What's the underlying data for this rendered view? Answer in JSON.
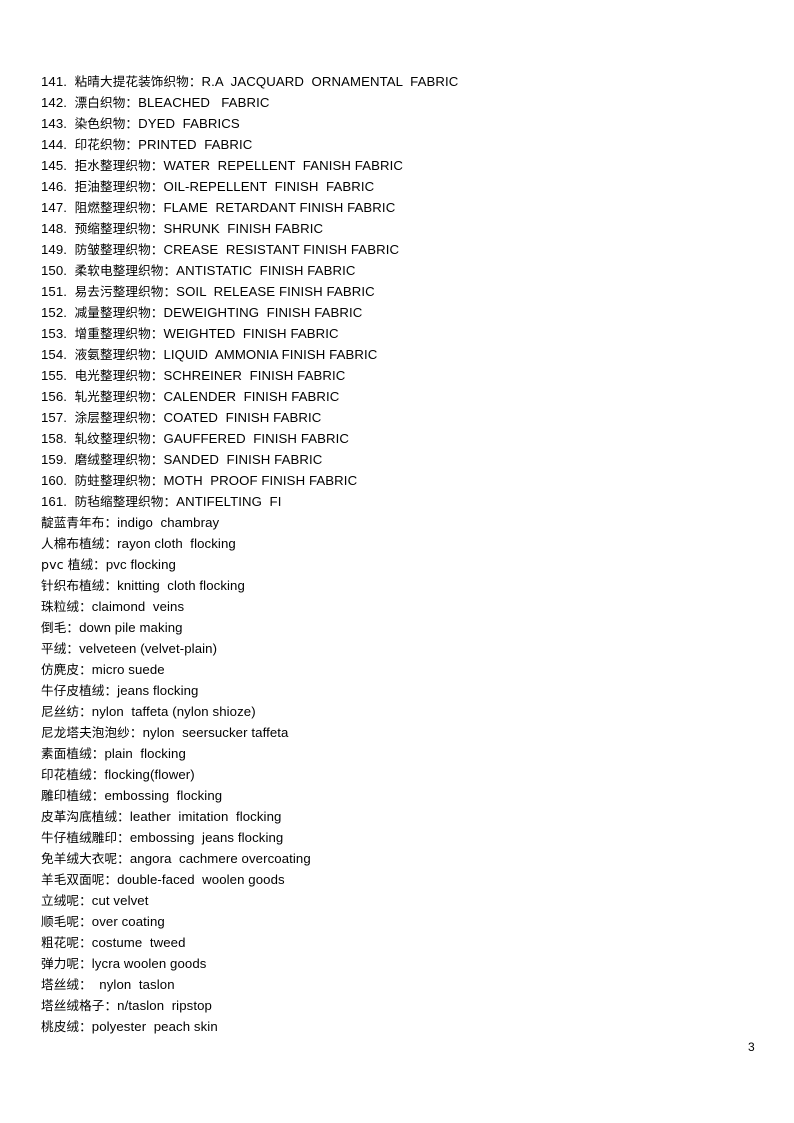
{
  "document": {
    "page_number": "3",
    "entries": [
      {
        "number": "141.",
        "cn": "粘晴大提花装饰织物：",
        "en": "R.A  JACQUARD  ORNAMENTAL  FABRIC"
      },
      {
        "number": "142.",
        "cn": "漂白织物：",
        "en": "BLEACHED   FABRIC"
      },
      {
        "number": "143.",
        "cn": "染色织物：",
        "en": "DYED  FABRICS"
      },
      {
        "number": "144.",
        "cn": "印花织物：",
        "en": "PRINTED  FABRIC"
      },
      {
        "number": "145.",
        "cn": "拒水整理织物：",
        "en": "WATER  REPELLENT  FANISH FABRIC"
      },
      {
        "number": "146.",
        "cn": "拒油整理织物：",
        "en": "OIL-REPELLENT  FINISH  FABRIC"
      },
      {
        "number": "147.",
        "cn": "阻燃整理织物：",
        "en": "FLAME  RETARDANT FINISH FABRIC"
      },
      {
        "number": "148.",
        "cn": "预缩整理织物：",
        "en": "SHRUNK  FINISH FABRIC"
      },
      {
        "number": "149.",
        "cn": "防皱整理织物：",
        "en": "CREASE  RESISTANT FINISH FABRIC"
      },
      {
        "number": "150.",
        "cn": "柔软电整理织物：",
        "en": "ANTISTATIC  FINISH FABRIC"
      },
      {
        "number": "151.",
        "cn": "易去污整理织物：",
        "en": "SOIL  RELEASE FINISH FABRIC"
      },
      {
        "number": "152.",
        "cn": "减量整理织物：",
        "en": "DEWEIGHTING  FINISH FABRIC"
      },
      {
        "number": "153.",
        "cn": "增重整理织物：",
        "en": "WEIGHTED  FINISH FABRIC"
      },
      {
        "number": "154.",
        "cn": "液氨整理织物：",
        "en": "LIQUID  AMMONIA FINISH FABRIC"
      },
      {
        "number": "155.",
        "cn": "电光整理织物：",
        "en": "SCHREINER  FINISH FABRIC"
      },
      {
        "number": "156.",
        "cn": "轧光整理织物：",
        "en": "CALENDER  FINISH FABRIC"
      },
      {
        "number": "157.",
        "cn": "涂层整理织物：",
        "en": "COATED  FINISH FABRIC"
      },
      {
        "number": "158.",
        "cn": "轧纹整理织物：",
        "en": "GAUFFERED  FINISH FABRIC"
      },
      {
        "number": "159.",
        "cn": "磨绒整理织物：",
        "en": "SANDED  FINISH FABRIC"
      },
      {
        "number": "160.",
        "cn": "防蛀整理织物：",
        "en": "MOTH  PROOF FINISH FABRIC"
      },
      {
        "number": "161.",
        "cn": "防毡缩整理织物：",
        "en": "ANTIFELTING  FI"
      },
      {
        "number": "",
        "cn": "靛蓝青年布：",
        "en": "indigo  chambray"
      },
      {
        "number": "",
        "cn": "人棉布植绒：",
        "en": "rayon cloth  flocking"
      },
      {
        "number": "",
        "cn": "pvc 植绒：",
        "en": "pvc flocking"
      },
      {
        "number": "",
        "cn": "针织布植绒：",
        "en": "knitting  cloth flocking"
      },
      {
        "number": "",
        "cn": "珠粒绒：",
        "en": "claimond  veins"
      },
      {
        "number": "",
        "cn": "倒毛：",
        "en": "down pile making"
      },
      {
        "number": "",
        "cn": "平绒：",
        "en": "velveteen (velvet-plain)"
      },
      {
        "number": "",
        "cn": "仿麂皮：",
        "en": "micro suede"
      },
      {
        "number": "",
        "cn": "牛仔皮植绒：",
        "en": "jeans flocking"
      },
      {
        "number": "",
        "cn": "尼丝纺：",
        "en": "nylon  taffeta (nylon shioze)"
      },
      {
        "number": "",
        "cn": "尼龙塔夫泡泡纱：",
        "en": "nylon  seersucker taffeta"
      },
      {
        "number": "",
        "cn": "素面植绒：",
        "en": "plain  flocking"
      },
      {
        "number": "",
        "cn": "印花植绒：",
        "en": "flocking(flower)"
      },
      {
        "number": "",
        "cn": "雕印植绒：",
        "en": "embossing  flocking"
      },
      {
        "number": "",
        "cn": "皮革沟底植绒：",
        "en": "leather  imitation  flocking"
      },
      {
        "number": "",
        "cn": "牛仔植绒雕印：",
        "en": "embossing  jeans flocking"
      },
      {
        "number": "",
        "cn": "免羊绒大衣呢：",
        "en": "angora  cachmere overcoating"
      },
      {
        "number": "",
        "cn": "羊毛双面呢：",
        "en": "double-faced  woolen goods"
      },
      {
        "number": "",
        "cn": "立绒呢：",
        "en": "cut velvet"
      },
      {
        "number": "",
        "cn": "顺毛呢：",
        "en": "over coating"
      },
      {
        "number": "",
        "cn": "粗花呢：",
        "en": "costume  tweed"
      },
      {
        "number": "",
        "cn": "弹力呢：",
        "en": "lycra woolen goods"
      },
      {
        "number": "",
        "cn": "塔丝绒：",
        "en": "  nylon  taslon"
      },
      {
        "number": "",
        "cn": "塔丝绒格子：",
        "en": "n/taslon  ripstop"
      },
      {
        "number": "",
        "cn": "桃皮绒：",
        "en": "polyester  peach skin"
      }
    ]
  }
}
